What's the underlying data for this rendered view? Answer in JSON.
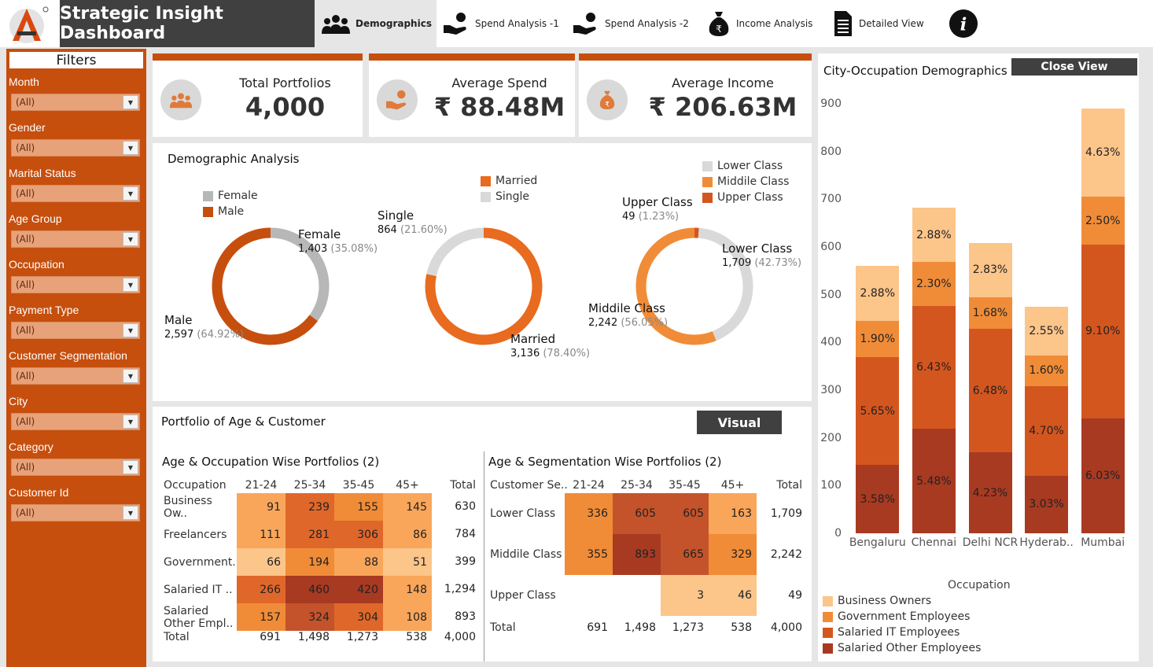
{
  "app": {
    "title": "Strategic Insight Dashboard",
    "logo_letter": "A"
  },
  "nav": [
    {
      "label": "Demographics",
      "icon": "people-icon",
      "active": true
    },
    {
      "label": "Spend Analysis -1",
      "icon": "hand-coin-icon",
      "active": false
    },
    {
      "label": "Spend Analysis -2",
      "icon": "hand-coin-icon",
      "active": false
    },
    {
      "label": "Income Analysis",
      "icon": "money-bag-icon",
      "active": false
    },
    {
      "label": "Detailed View",
      "icon": "document-icon",
      "active": false
    },
    {
      "label": "",
      "icon": "info-icon",
      "active": false
    }
  ],
  "filters": {
    "title": "Filters",
    "items": [
      {
        "label": "Month",
        "value": "(All)"
      },
      {
        "label": "Gender",
        "value": "(All)"
      },
      {
        "label": "Marital Status",
        "value": "(All)"
      },
      {
        "label": "Age Group",
        "value": "(All)"
      },
      {
        "label": "Occupation",
        "value": "(All)"
      },
      {
        "label": "Payment Type",
        "value": "(All)"
      },
      {
        "label": "Customer Segmentation",
        "value": "(All)"
      },
      {
        "label": "City",
        "value": "(All)"
      },
      {
        "label": "Category",
        "value": "(All)"
      },
      {
        "label": "Customer Id",
        "value": "(All)"
      }
    ]
  },
  "kpis": [
    {
      "title": "Total Portfolios",
      "value": "4,000",
      "icon": "people-icon"
    },
    {
      "title": "Average Spend",
      "value": "₹ 88.48M",
      "icon": "hand-coin-icon"
    },
    {
      "title": "Average Income",
      "value": "₹ 206.63M",
      "icon": "money-bag-icon"
    }
  ],
  "demographic": {
    "title": "Demographic Analysis",
    "gender": {
      "legend": [
        "Female",
        "Male"
      ],
      "female": {
        "label": "Female",
        "count": "1,403",
        "pct": "(35.08%)",
        "value": 35.08
      },
      "male": {
        "label": "Male",
        "count": "2,597",
        "pct": "(64.92%)",
        "value": 64.92
      }
    },
    "marital": {
      "legend": [
        "Married",
        "Single"
      ],
      "single": {
        "label": "Single",
        "count": "864",
        "pct": "(21.60%)",
        "value": 21.6
      },
      "married": {
        "label": "Married",
        "count": "3,136",
        "pct": "(78.40%)",
        "value": 78.4
      }
    },
    "segment": {
      "legend": [
        "Lower Class",
        "Middile Class",
        "Upper Class"
      ],
      "upper": {
        "label": "Upper Class",
        "count": "49",
        "pct": "(1.23%)",
        "value": 1.23
      },
      "lower": {
        "label": "Lower Class",
        "count": "1,709",
        "pct": "(42.73%)",
        "value": 42.73
      },
      "middle": {
        "label": "Middile Class",
        "count": "2,242",
        "pct": "(56.05%)",
        "value": 56.05
      }
    }
  },
  "portfolio": {
    "title": "Portfolio of Age & Customer",
    "visual_button": "Visual",
    "occupation_table": {
      "title": "Age & Occupation Wise Portfolios (2)",
      "headers": [
        "Occupation",
        "21-24",
        "25-34",
        "35-45",
        "45+",
        "Total"
      ],
      "rows": [
        {
          "label": "Business Ow..",
          "values": [
            "91",
            "239",
            "155",
            "145"
          ],
          "total": "630"
        },
        {
          "label": "Freelancers",
          "values": [
            "111",
            "281",
            "306",
            "86"
          ],
          "total": "784"
        },
        {
          "label": "Government..",
          "values": [
            "66",
            "194",
            "88",
            "51"
          ],
          "total": "399"
        },
        {
          "label": "Salaried IT ..",
          "values": [
            "266",
            "460",
            "420",
            "148"
          ],
          "total": "1,294"
        },
        {
          "label": "Salaried Other Empl..",
          "values": [
            "157",
            "324",
            "304",
            "108"
          ],
          "total": "893"
        }
      ],
      "total_row": {
        "label": "Total",
        "values": [
          "691",
          "1,498",
          "1,273",
          "538"
        ],
        "total": "4,000"
      }
    },
    "segment_table": {
      "title": "Age & Segmentation Wise Portfolios (2)",
      "headers": [
        "Customer Se..",
        "21-24",
        "25-34",
        "35-45",
        "45+",
        "Total"
      ],
      "rows": [
        {
          "label": "Lower Class",
          "values": [
            "336",
            "605",
            "605",
            "163"
          ],
          "total": "1,709"
        },
        {
          "label": "Middile Class",
          "values": [
            "355",
            "893",
            "665",
            "329"
          ],
          "total": "2,242"
        },
        {
          "label": "Upper Class",
          "values": [
            "",
            "",
            "3",
            "46"
          ],
          "total": "49"
        }
      ],
      "total_row": {
        "label": "Total",
        "values": [
          "691",
          "1,498",
          "1,273",
          "538"
        ],
        "total": "4,000"
      }
    }
  },
  "city_panel": {
    "title": "City-Occupation Demographics",
    "close_button": "Close View"
  },
  "chart_data": {
    "type": "bar",
    "stacked": true,
    "categories": [
      "Bengaluru",
      "Chennai",
      "Delhi NCR",
      "Hyderab..",
      "Mumbai"
    ],
    "y_ticks": [
      "0",
      "100",
      "200",
      "300",
      "400",
      "500",
      "600",
      "700",
      "800",
      "900"
    ],
    "ylim": [
      0,
      900
    ],
    "legend_title": "Occupation",
    "series": [
      {
        "name": "Salaried Other Employees",
        "color": "#a83a22",
        "values": [
          143,
          219,
          169,
          121,
          241
        ],
        "labels": [
          "3.58%",
          "5.48%",
          "4.23%",
          "3.03%",
          "6.03%"
        ]
      },
      {
        "name": "Salaried IT Employees",
        "color": "#d4561f",
        "values": [
          226,
          257,
          259,
          188,
          364
        ],
        "labels": [
          "5.65%",
          "6.43%",
          "6.48%",
          "4.70%",
          "9.10%"
        ]
      },
      {
        "name": "Government Employees",
        "color": "#f08c37",
        "values": [
          76,
          92,
          67,
          64,
          100
        ],
        "labels": [
          "1.90%",
          "2.30%",
          "1.68%",
          "1.60%",
          "2.50%"
        ]
      },
      {
        "name": "Business Owners",
        "color": "#fcc58a",
        "values": [
          115,
          115,
          113,
          102,
          185
        ],
        "labels": [
          "2.88%",
          "2.88%",
          "2.83%",
          "2.55%",
          "4.63%"
        ]
      }
    ]
  },
  "colors": {
    "brand": "#c64f0e",
    "dark": "#404040",
    "gray_ring": "#b7b7b7",
    "light_gray_ring": "#d9d9d9"
  }
}
